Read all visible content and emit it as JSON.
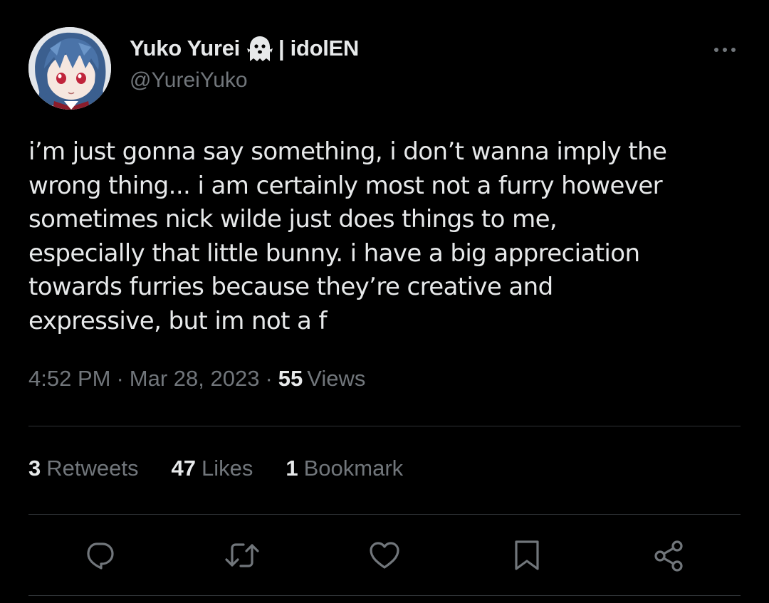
{
  "author": {
    "display_name": "Yuko Yurei",
    "name_suffix": "| idolEN",
    "handle": "@YureiYuko",
    "avatar_icon": "anime-avatar",
    "badge_icon": "ghost-icon"
  },
  "tweet": {
    "text_lines": [
      "i’m just gonna say something, i don’t wanna imply the",
      "wrong thing... i am certainly most not a furry however",
      "sometimes nick wilde just does things to me,",
      "especially that little bunny. i have a big appreciation",
      "towards furries because they’re creative and",
      "expressive, but im not a f"
    ],
    "time": "4:52 PM",
    "date": "Mar 28, 2023",
    "separator": "·",
    "views_count": "55",
    "views_label": "Views"
  },
  "stats": {
    "retweets_count": "3",
    "retweets_label": "Retweets",
    "likes_count": "47",
    "likes_label": "Likes",
    "bookmarks_count": "1",
    "bookmarks_label": "Bookmark"
  },
  "actions": {
    "reply_icon": "reply-icon",
    "retweet_icon": "retweet-icon",
    "like_icon": "heart-icon",
    "bookmark_icon": "bookmark-icon",
    "share_icon": "share-icon"
  },
  "colors": {
    "background": "#000000",
    "text_primary": "#e7e9ea",
    "text_secondary": "#71767b",
    "divider": "#2f3336"
  }
}
